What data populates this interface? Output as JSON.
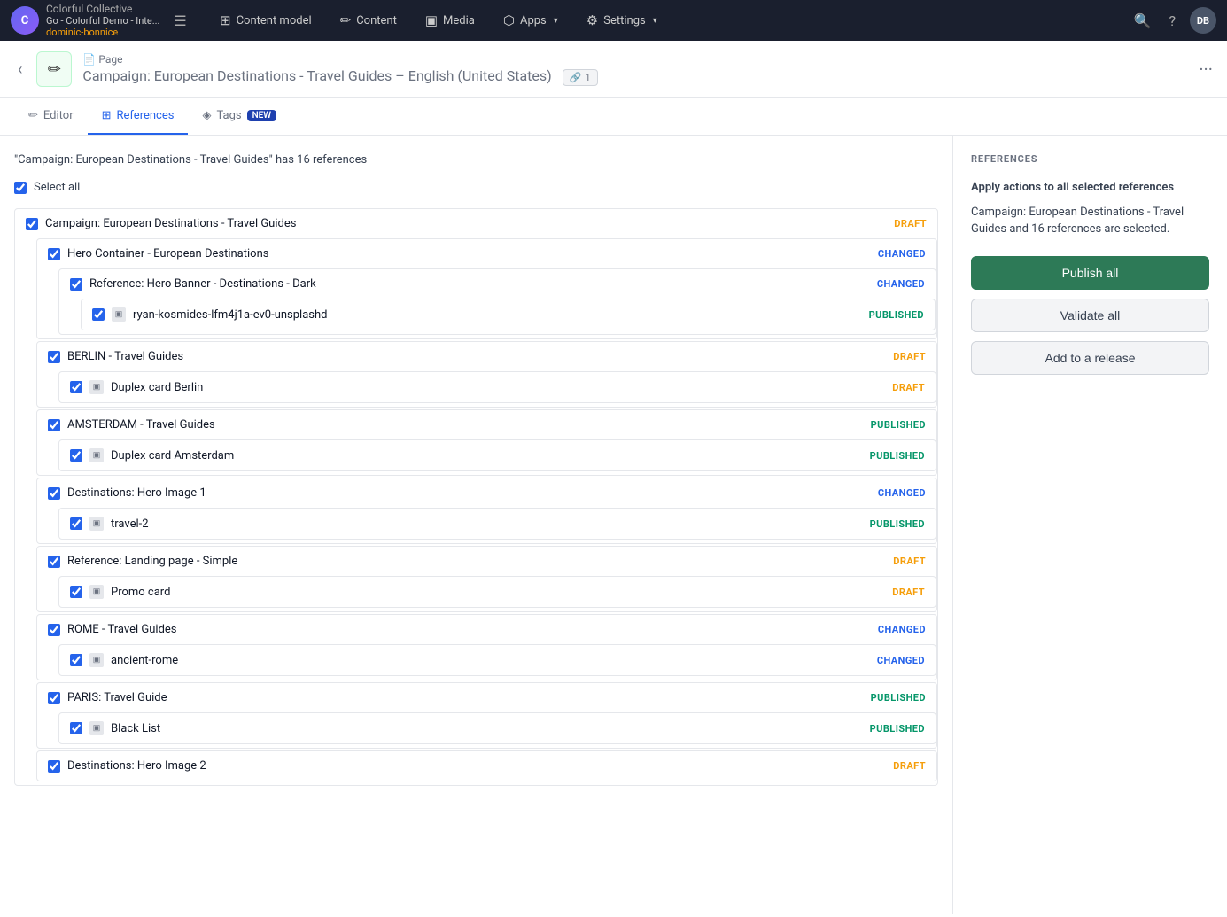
{
  "app": {
    "brand": {
      "logo_text": "C",
      "org_name": "Colorful Collective",
      "instance_name": "Go - Colorful Demo - Inte...",
      "user_tag": "dominic-bonnice"
    },
    "nav_items": [
      {
        "id": "content-model",
        "icon": "⊞",
        "label": "Content model",
        "has_arrow": false
      },
      {
        "id": "content",
        "icon": "✏",
        "label": "Content",
        "has_arrow": false
      },
      {
        "id": "media",
        "icon": "▣",
        "label": "Media",
        "has_arrow": false
      },
      {
        "id": "apps",
        "icon": "⬡",
        "label": "Apps",
        "has_arrow": true
      },
      {
        "id": "settings",
        "icon": "⚙",
        "label": "Settings",
        "has_arrow": true
      }
    ],
    "user_initials": "DB"
  },
  "entry": {
    "breadcrumb": "📄 Page",
    "title": "Campaign: European Destinations - Travel Guides",
    "locale": "– English (United States)",
    "ref_count": "1"
  },
  "tabs": [
    {
      "id": "editor",
      "label": "Editor",
      "icon": "✏",
      "active": false
    },
    {
      "id": "references",
      "label": "References",
      "icon": "⊞",
      "active": true
    },
    {
      "id": "tags",
      "label": "Tags",
      "badge": "NEW",
      "icon": "◈",
      "active": false
    }
  ],
  "references": {
    "summary": "\"Campaign: European Destinations - Travel Guides\" has 16 references",
    "select_all_label": "Select all",
    "items": [
      {
        "id": "campaign-root",
        "label": "Campaign: European Destinations - Travel Guides",
        "status": "DRAFT",
        "status_class": "status-draft",
        "checked": true,
        "children": [
          {
            "id": "hero-container",
            "label": "Hero Container - European Destinations",
            "status": "CHANGED",
            "status_class": "status-changed",
            "checked": true,
            "children": [
              {
                "id": "hero-banner",
                "label": "Reference: Hero Banner - Destinations - Dark",
                "status": "CHANGED",
                "status_class": "status-changed",
                "checked": true,
                "children": [
                  {
                    "id": "ryan-kosmides",
                    "label": "ryan-kosmides-lfm4j1a-ev0-unsplashd",
                    "status": "PUBLISHED",
                    "status_class": "status-published",
                    "checked": true,
                    "is_media": true
                  }
                ]
              }
            ]
          },
          {
            "id": "berlin",
            "label": "BERLIN - Travel Guides",
            "status": "DRAFT",
            "status_class": "status-draft",
            "checked": true,
            "children": [
              {
                "id": "duplex-berlin",
                "label": "Duplex card Berlin",
                "status": "DRAFT",
                "status_class": "status-draft",
                "checked": true,
                "is_media": true
              }
            ]
          },
          {
            "id": "amsterdam",
            "label": "AMSTERDAM - Travel Guides",
            "status": "PUBLISHED",
            "status_class": "status-published",
            "checked": true,
            "children": [
              {
                "id": "duplex-amsterdam",
                "label": "Duplex card Amsterdam",
                "status": "PUBLISHED",
                "status_class": "status-published",
                "checked": true,
                "is_media": true
              }
            ]
          },
          {
            "id": "destinations-hero-1",
            "label": "Destinations: Hero Image 1",
            "status": "CHANGED",
            "status_class": "status-changed",
            "checked": true,
            "children": [
              {
                "id": "travel-2",
                "label": "travel-2",
                "status": "PUBLISHED",
                "status_class": "status-published",
                "checked": true,
                "is_media": true
              }
            ]
          },
          {
            "id": "landing-page-simple",
            "label": "Reference: Landing page - Simple",
            "status": "DRAFT",
            "status_class": "status-draft",
            "checked": true,
            "children": [
              {
                "id": "promo-card",
                "label": "Promo card",
                "status": "DRAFT",
                "status_class": "status-draft",
                "checked": true,
                "is_media": true
              }
            ]
          },
          {
            "id": "rome",
            "label": "ROME - Travel Guides",
            "status": "CHANGED",
            "status_class": "status-changed",
            "checked": true,
            "children": [
              {
                "id": "ancient-rome",
                "label": "ancient-rome",
                "status": "CHANGED",
                "status_class": "status-changed",
                "checked": true,
                "is_media": true
              }
            ]
          },
          {
            "id": "paris",
            "label": "PARIS: Travel Guide",
            "status": "PUBLISHED",
            "status_class": "status-published",
            "checked": true,
            "children": [
              {
                "id": "black-list",
                "label": "Black List",
                "status": "PUBLISHED",
                "status_class": "status-published",
                "checked": true,
                "is_media": true
              }
            ]
          },
          {
            "id": "destinations-hero-2",
            "label": "Destinations: Hero Image 2",
            "status": "DRAFT",
            "status_class": "status-draft",
            "checked": true,
            "children": []
          }
        ]
      }
    ]
  },
  "sidebar": {
    "section_title": "REFERENCES",
    "apply_label": "Apply actions to all selected references",
    "selection_desc": "Campaign: European Destinations - Travel Guides and 16 references are selected.",
    "publish_all_label": "Publish all",
    "validate_all_label": "Validate all",
    "add_to_release_label": "Add to a release"
  }
}
